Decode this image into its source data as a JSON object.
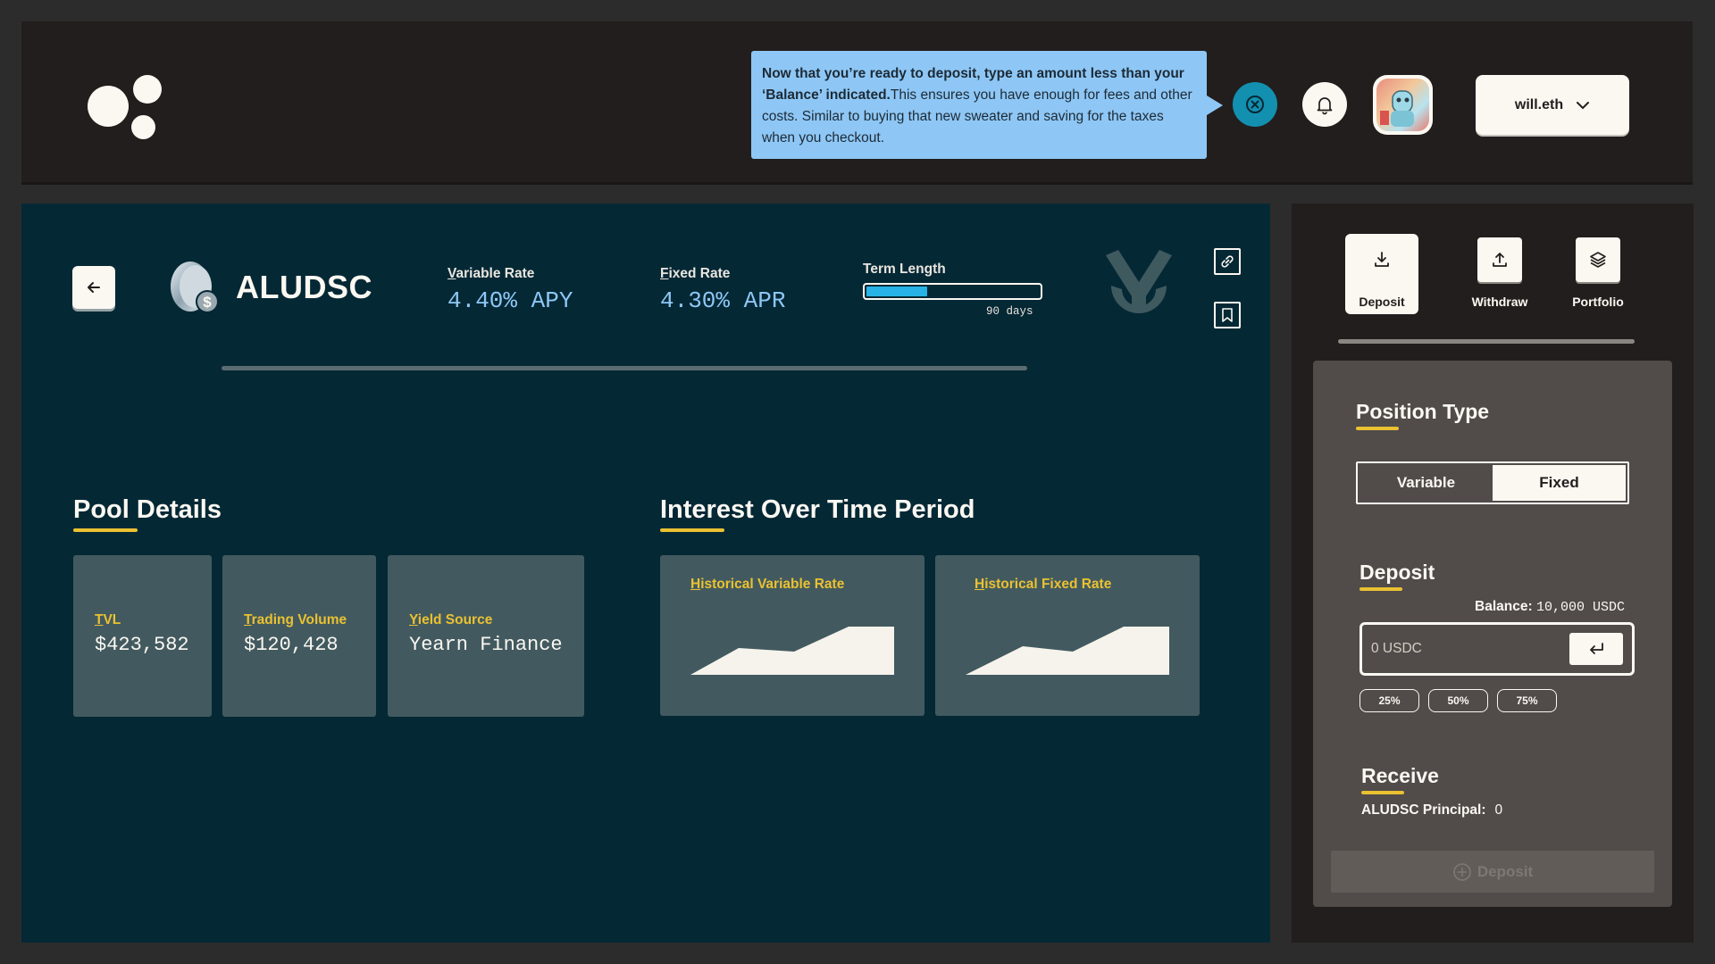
{
  "header": {
    "tooltip": {
      "bold_text": "Now that you’re ready to deposit, type an amount less than your ‘Balance’ indicated.",
      "text": "This ensures you have enough for fees and other costs. Similar to buying that new sweater and saving for the taxes when you checkout."
    },
    "wallet_label": "will.eth",
    "icons": [
      "close-icon",
      "bell-icon",
      "chevron-down-icon"
    ]
  },
  "pool": {
    "name": "ALUDSC",
    "variable_rate_label": "Variable Rate",
    "variable_rate_value": "4.40% APY",
    "fixed_rate_label": "Fixed Rate",
    "fixed_rate_value": "4.30% APR",
    "term_label": "Term Length",
    "term_days": "90 days",
    "term_progress": 0.35
  },
  "pool_details": {
    "title": "Pool Details",
    "tvl_label": "TVL",
    "tvl_value": "$423,582",
    "volume_label": "Trading Volume",
    "volume_value": "$120,428",
    "yield_label": "Yield Source",
    "yield_value": "Yearn Finance"
  },
  "interest": {
    "title": "Interest Over Time Period",
    "variable_label": "Historical Variable Rate",
    "fixed_label": "Historical Fixed Rate"
  },
  "sidebar": {
    "tabs": [
      {
        "label": "Deposit",
        "icon": "download-icon"
      },
      {
        "label": "Withdraw",
        "icon": "upload-icon"
      },
      {
        "label": "Portfolio",
        "icon": "layers-icon"
      }
    ],
    "position_type_title": "Position Type",
    "position_options": [
      "Variable",
      "Fixed"
    ],
    "selected_position": "Fixed",
    "deposit_title": "Deposit",
    "balance_label": "Balance:",
    "balance_value": "10,000 USDC",
    "amount_placeholder": "0 USDC",
    "percent_options": [
      "25%",
      "50%",
      "75%"
    ],
    "receive_title": "Receive",
    "receive_label": "ALUDSC Principal:",
    "receive_value": "0",
    "deposit_button_label": "Deposit"
  },
  "colors": {
    "accent_yellow": "#eac131",
    "rate_blue": "#8ec7f5",
    "panel_teal": "#052835",
    "card_teal": "#425a5f",
    "tooltip_blue": "#8ec7f5",
    "term_fill": "#27b3e5"
  }
}
